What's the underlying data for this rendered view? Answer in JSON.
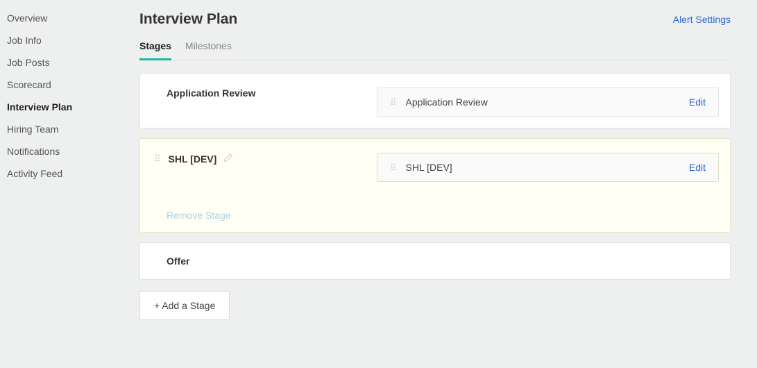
{
  "sidebar": {
    "items": [
      {
        "label": "Overview",
        "active": false
      },
      {
        "label": "Job Info",
        "active": false
      },
      {
        "label": "Job Posts",
        "active": false
      },
      {
        "label": "Scorecard",
        "active": false
      },
      {
        "label": "Interview Plan",
        "active": true
      },
      {
        "label": "Hiring Team",
        "active": false
      },
      {
        "label": "Notifications",
        "active": false
      },
      {
        "label": "Activity Feed",
        "active": false
      }
    ]
  },
  "header": {
    "title": "Interview Plan",
    "alert_link": "Alert Settings"
  },
  "tabs": [
    {
      "label": "Stages",
      "active": true
    },
    {
      "label": "Milestones",
      "active": false
    }
  ],
  "stages": [
    {
      "id": "application-review",
      "title": "Application Review",
      "highlight": false,
      "draggable": false,
      "editable_title": false,
      "removable": false,
      "interviews": [
        {
          "label": "Application Review",
          "edit": "Edit"
        }
      ]
    },
    {
      "id": "shl-dev",
      "title": "SHL [DEV]",
      "highlight": true,
      "draggable": true,
      "editable_title": true,
      "removable": true,
      "remove_label": "Remove Stage",
      "interviews": [
        {
          "label": "SHL [DEV]",
          "edit": "Edit"
        }
      ]
    }
  ],
  "offer_stage": {
    "title": "Offer"
  },
  "add_stage_button": "+ Add a Stage"
}
